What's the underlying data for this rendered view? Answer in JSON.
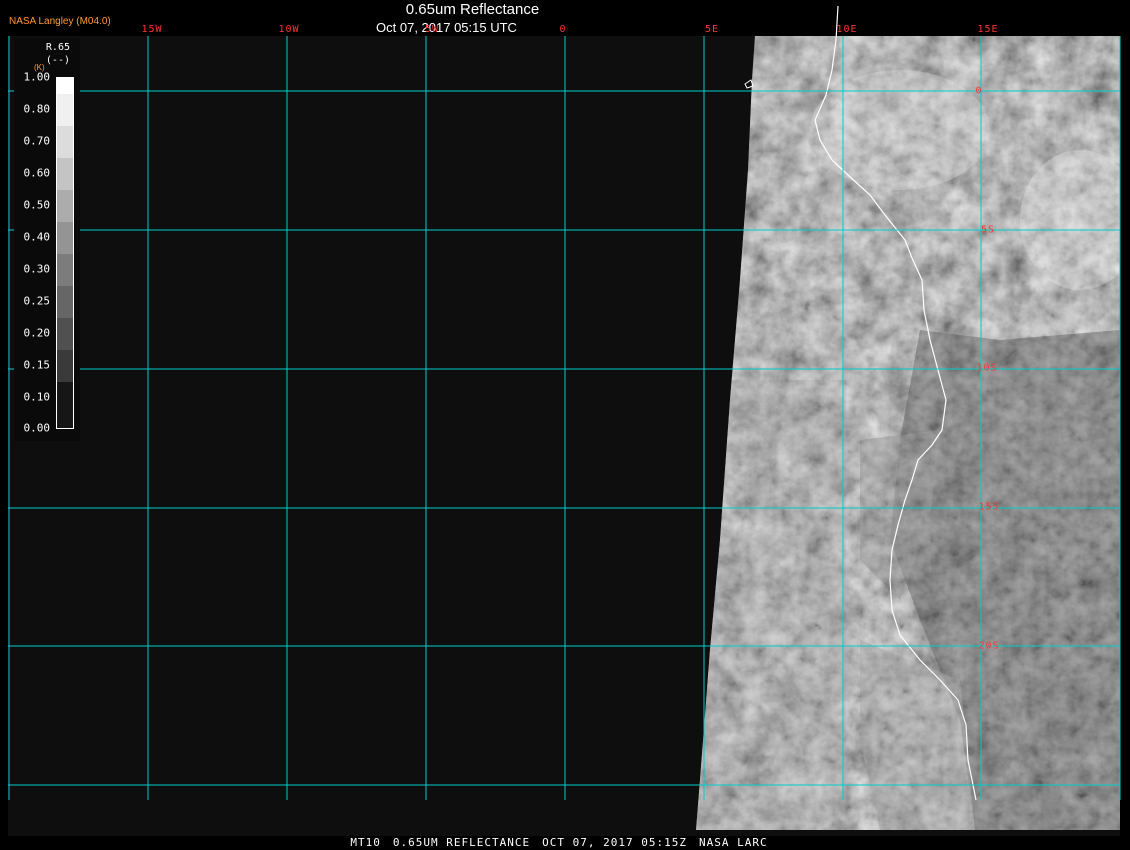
{
  "header": {
    "title": "0.65um Reflectance",
    "datetime": "Oct 07, 2017 05:15 UTC",
    "producer": "NASA Langley (M04.0)"
  },
  "map": {
    "lon_labels": [
      "15W",
      "10W",
      "5W",
      "0",
      "5E",
      "10E",
      "15E"
    ],
    "lat_labels": [
      "0",
      "5S",
      "10S",
      "15S",
      "20S"
    ],
    "gridline_color": "#00cccc",
    "label_color": "#ff3333",
    "coastline_color": "#ffffff"
  },
  "colorbar": {
    "name": "R.65",
    "unit": "(--)",
    "sub": "(K)",
    "ticks": [
      "1.00",
      "0.80",
      "0.70",
      "0.60",
      "0.50",
      "0.40",
      "0.30",
      "0.25",
      "0.20",
      "0.15",
      "0.10",
      "0.00"
    ]
  },
  "footer": {
    "satellite": "MT10",
    "product": "0.65UM REFLECTANCE",
    "date": "OCT 07, 2017 05:15Z",
    "source": "NASA LARC"
  }
}
